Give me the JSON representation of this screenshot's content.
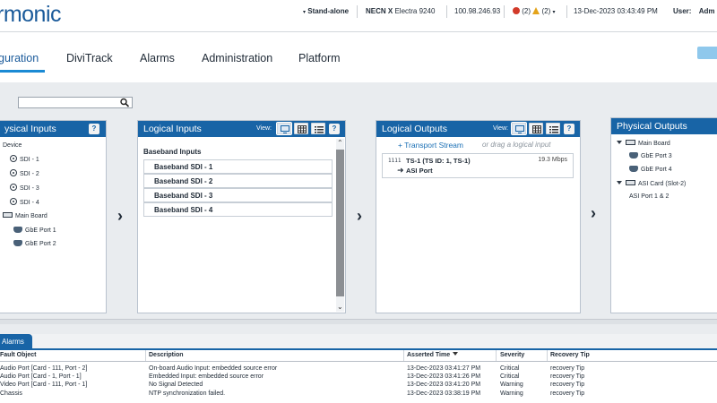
{
  "header": {
    "logo": "rmonic",
    "mode": "Stand-alone",
    "device_model": "NECN X",
    "device_name": "Electra 9240",
    "ip": "100.98.246.93",
    "alarm_critical_count": "(2)",
    "alarm_warning_count": "(2)",
    "datetime": "13-Dec-2023 03:43:49 PM",
    "user_label": "User:",
    "user_value": "Adm"
  },
  "nav": {
    "tabs": [
      "guration",
      "DiviTrack",
      "Alarms",
      "Administration",
      "Platform"
    ]
  },
  "filter": {
    "value": "",
    "placeholder": ""
  },
  "physical_inputs": {
    "title": "ysical Inputs",
    "help": "?",
    "device_label": "Device",
    "items": [
      "SDI - 1",
      "SDI - 2",
      "SDI - 3",
      "SDI - 4"
    ],
    "main_board": "Main Board",
    "gbe_ports": [
      "GbE Port 1",
      "GbE Port 2"
    ]
  },
  "logical_inputs": {
    "title": "Logical Inputs",
    "view_label": "View:",
    "help": "?",
    "group": "Baseband Inputs",
    "items": [
      "Baseband SDI - 1",
      "Baseband SDI - 2",
      "Baseband SDI - 3",
      "Baseband SDI - 4"
    ]
  },
  "logical_outputs": {
    "title": "Logical Outputs",
    "view_label": "View:",
    "help": "?",
    "add_link": "+ Transport Stream",
    "hint": "or drag a logical input",
    "ts_icon": "1111",
    "ts_name": "TS-1 (TS ID: 1, TS-1)",
    "ts_rate": "19.3 Mbps",
    "asi_port": "ASI Port"
  },
  "physical_outputs": {
    "title": "Physical Outputs",
    "main_board": "Main Board",
    "gbe_ports": [
      "GbE Port 3",
      "GbE Port 4"
    ],
    "asi_card": "ASI Card (Slot-2)",
    "asi_ports": "ASI Port 1 & 2"
  },
  "alarms": {
    "tab_label": "Alarms",
    "columns": [
      "Fault Object",
      "Description",
      "Asserted Time",
      "Severity",
      "Recovery Tip"
    ],
    "rows": [
      [
        "Audio Port [Card - 111, Port - 2]",
        "On-board Audio Input: embedded source error",
        "13-Dec-2023 03:41:27 PM",
        "Critical",
        "recovery Tip"
      ],
      [
        "Audio Port [Card - 1, Port - 1]",
        "Embedded Input: embedded source error",
        "13-Dec-2023 03:41:26 PM",
        "Critical",
        "recovery Tip"
      ],
      [
        "Video Port [Card - 111, Port - 1]",
        "No Signal Detected",
        "13-Dec-2023 03:41:20 PM",
        "Warning",
        "recovery Tip"
      ],
      [
        "Chassis",
        "NTP synchronization failed.",
        "13-Dec-2023 03:38:19 PM",
        "Warning",
        "recovery Tip"
      ]
    ]
  },
  "colors": {
    "panel_header": "#1864a6",
    "link": "#1a6fb5",
    "critical": "#d23a2a",
    "warning": "#e4a31a"
  },
  "icons": [
    "search-icon",
    "monitor-icon",
    "grid-icon",
    "list-icon",
    "help-icon",
    "chevron-right-icon",
    "sdi-port-icon",
    "card-icon",
    "gbe-port-icon",
    "transport-stream-icon",
    "asi-arrow-icon",
    "critical-alarm-icon",
    "warning-alarm-icon",
    "dropdown-icon"
  ]
}
